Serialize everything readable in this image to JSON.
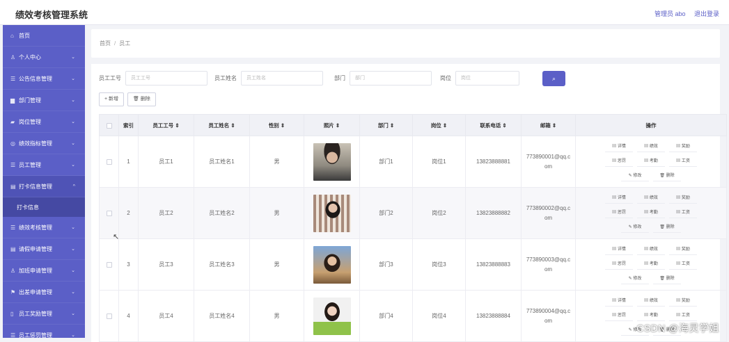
{
  "app": {
    "title": "绩效考核管理系统"
  },
  "topbar": {
    "user": "管理员 abo",
    "logout": "退出登录"
  },
  "sidebar": {
    "items": [
      {
        "icon": "⌂",
        "label": "首页",
        "arrow": ""
      },
      {
        "icon": "♙",
        "label": "个人中心",
        "arrow": "⌄"
      },
      {
        "icon": "☰",
        "label": "公告信息管理",
        "arrow": "⌄"
      },
      {
        "icon": "▆",
        "label": "部门管理",
        "arrow": "⌄"
      },
      {
        "icon": "▰",
        "label": "岗位管理",
        "arrow": "⌄"
      },
      {
        "icon": "◎",
        "label": "绩效指标管理",
        "arrow": "⌄"
      },
      {
        "icon": "☰",
        "label": "员工管理",
        "arrow": "⌄"
      },
      {
        "icon": "▤",
        "label": "打卡信息管理",
        "arrow": "^"
      },
      {
        "icon": "☰",
        "label": "绩效考核管理",
        "arrow": "⌄"
      },
      {
        "icon": "▤",
        "label": "请假申请管理",
        "arrow": "⌄"
      },
      {
        "icon": "♙",
        "label": "加班申请管理",
        "arrow": "⌄"
      },
      {
        "icon": "⚑",
        "label": "出差申请管理",
        "arrow": "⌄"
      },
      {
        "icon": "▯",
        "label": "员工奖励管理",
        "arrow": "⌄"
      },
      {
        "icon": "☰",
        "label": "员工惩罚管理",
        "arrow": "⌄"
      }
    ],
    "sub_item": "打卡信息"
  },
  "breadcrumb": {
    "home": "首页",
    "sep": "/",
    "current": "员工"
  },
  "search": {
    "f1_label": "员工工号",
    "f1_ph": "员工工号",
    "f2_label": "员工姓名",
    "f2_ph": "员工姓名",
    "f3_label": "部门",
    "f3_ph": "部门",
    "f4_label": "岗位",
    "f4_ph": "岗位",
    "btn": "⌕"
  },
  "actions": {
    "add": "+ 新增",
    "delete": "🗑 删除"
  },
  "table": {
    "headers": [
      "",
      "索引",
      "员工工号 ⇕",
      "员工姓名 ⇕",
      "性别 ⇕",
      "照片 ⇕",
      "部门 ⇕",
      "岗位 ⇕",
      "联系电话 ⇕",
      "邮箱 ⇕",
      "操作"
    ],
    "rows": [
      {
        "idx": "1",
        "no": "员工1",
        "name": "员工姓名1",
        "sex": "男",
        "dept": "部门1",
        "post": "岗位1",
        "phone": "13823888881",
        "email": "773890001@qq.com"
      },
      {
        "idx": "2",
        "no": "员工2",
        "name": "员工姓名2",
        "sex": "男",
        "dept": "部门2",
        "post": "岗位2",
        "phone": "13823888882",
        "email": "773890002@qq.com"
      },
      {
        "idx": "3",
        "no": "员工3",
        "name": "员工姓名3",
        "sex": "男",
        "dept": "部门3",
        "post": "岗位3",
        "phone": "13823888883",
        "email": "773890003@qq.com"
      },
      {
        "idx": "4",
        "no": "员工4",
        "name": "员工姓名4",
        "sex": "男",
        "dept": "部门4",
        "post": "岗位4",
        "phone": "13823888884",
        "email": "773890004@qq.com"
      }
    ],
    "ops": [
      "▤ 详情",
      "▤ 绩效",
      "▤ 奖励",
      "▤ 惩罚",
      "▤ 考勤",
      "▤ 工资",
      "✎ 修改",
      "🗑 删除"
    ]
  },
  "watermark": "CSDN @海灵学姐",
  "colors": {
    "accent": "#5b5fc7",
    "sidebar_open": "#4f53b6"
  }
}
